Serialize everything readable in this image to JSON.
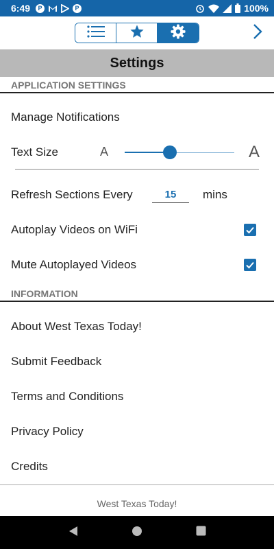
{
  "status_bar": {
    "time": "6:49",
    "battery": "100%",
    "left_icons": [
      "p-circle-icon",
      "gmail-icon",
      "play-store-icon",
      "p-circle-icon"
    ],
    "right_icons": [
      "alarm-icon",
      "wifi-icon",
      "signal-icon",
      "battery-icon"
    ]
  },
  "toolbar": {
    "tabs": [
      {
        "icon": "list-icon",
        "active": false
      },
      {
        "icon": "star-icon",
        "active": false
      },
      {
        "icon": "gear-icon",
        "active": true
      }
    ],
    "next_icon": "chevron-right-icon"
  },
  "title": "Settings",
  "sections": {
    "application": {
      "header": "APPLICATION SETTINGS",
      "manage_notifications": "Manage Notifications",
      "text_size": {
        "label": "Text Size",
        "small_glyph": "A",
        "large_glyph": "A",
        "value_fraction": 0.41
      },
      "refresh": {
        "label": "Refresh Sections Every",
        "value": "15",
        "unit": "mins"
      },
      "autoplay_wifi": {
        "label": "Autoplay Videos on WiFi",
        "checked": true
      },
      "mute_autoplayed": {
        "label": "Mute Autoplayed Videos",
        "checked": true
      }
    },
    "information": {
      "header": "INFORMATION",
      "items": [
        "About West Texas Today!",
        "Submit Feedback",
        "Terms and Conditions",
        "Privacy Policy",
        "Credits"
      ]
    }
  },
  "footer": "West Texas Today!",
  "colors": {
    "accent": "#1a6fb0",
    "status_bar": "#1565a8",
    "title_bar": "#b8b8b8"
  }
}
